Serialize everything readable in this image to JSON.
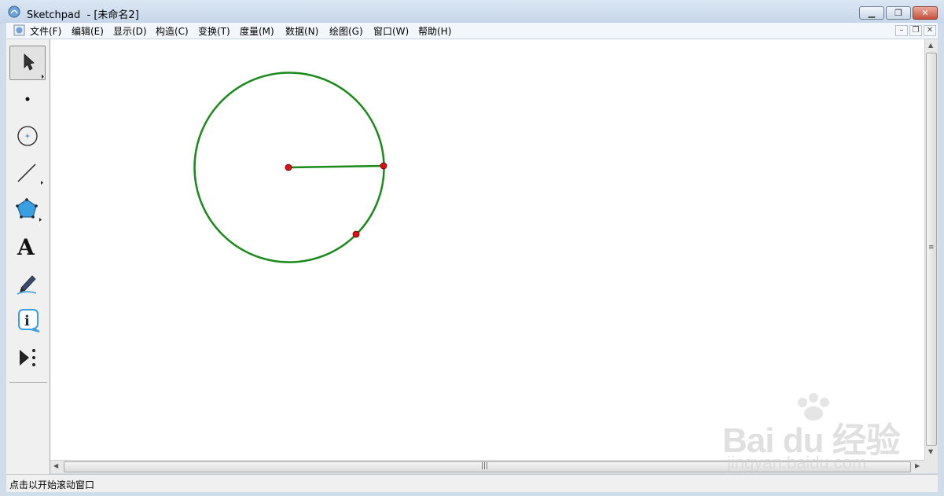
{
  "window": {
    "title": "Sketchpad  - [未命名2]",
    "controls": {
      "minimize": "▁",
      "maximize": "❐",
      "close": "✕"
    }
  },
  "menu": {
    "items": [
      "文件(F)",
      "编辑(E)",
      "显示(D)",
      "构造(C)",
      "变换(T)",
      "度量(M)",
      "数据(N)",
      "绘图(G)",
      "窗口(W)",
      "帮助(H)"
    ],
    "mdi_controls": {
      "minimize": "–",
      "restore": "❐",
      "close": "✕"
    }
  },
  "toolbox": {
    "tools": [
      {
        "name": "selection-arrow-tool",
        "icon": "arrow-icon",
        "active": true
      },
      {
        "name": "point-tool",
        "icon": "point-icon",
        "active": false
      },
      {
        "name": "compass-tool",
        "icon": "circle-icon",
        "active": false
      },
      {
        "name": "straightedge-tool",
        "icon": "segment-icon",
        "active": false
      },
      {
        "name": "polygon-tool",
        "icon": "polygon-icon",
        "active": false
      },
      {
        "name": "text-tool",
        "icon": "text-A-icon",
        "label": "A",
        "active": false
      },
      {
        "name": "marker-tool",
        "icon": "marker-pen-icon",
        "active": false
      },
      {
        "name": "information-tool",
        "icon": "info-icon",
        "label": "i",
        "active": false
      },
      {
        "name": "custom-tool",
        "icon": "play-custom-icon",
        "active": false
      }
    ]
  },
  "canvas": {
    "background": "#ffffff",
    "circle_color": "#1a8a1a",
    "segment_color": "#1a8a1a",
    "point_color": "#e01010"
  },
  "scrollbars": {
    "h_grip": "|||",
    "v_grip": "≡"
  },
  "status": {
    "text": "点击以开始滚动窗口"
  },
  "watermark": {
    "main": "Bai du 经验",
    "sub": "jingyan.baidu.com"
  }
}
